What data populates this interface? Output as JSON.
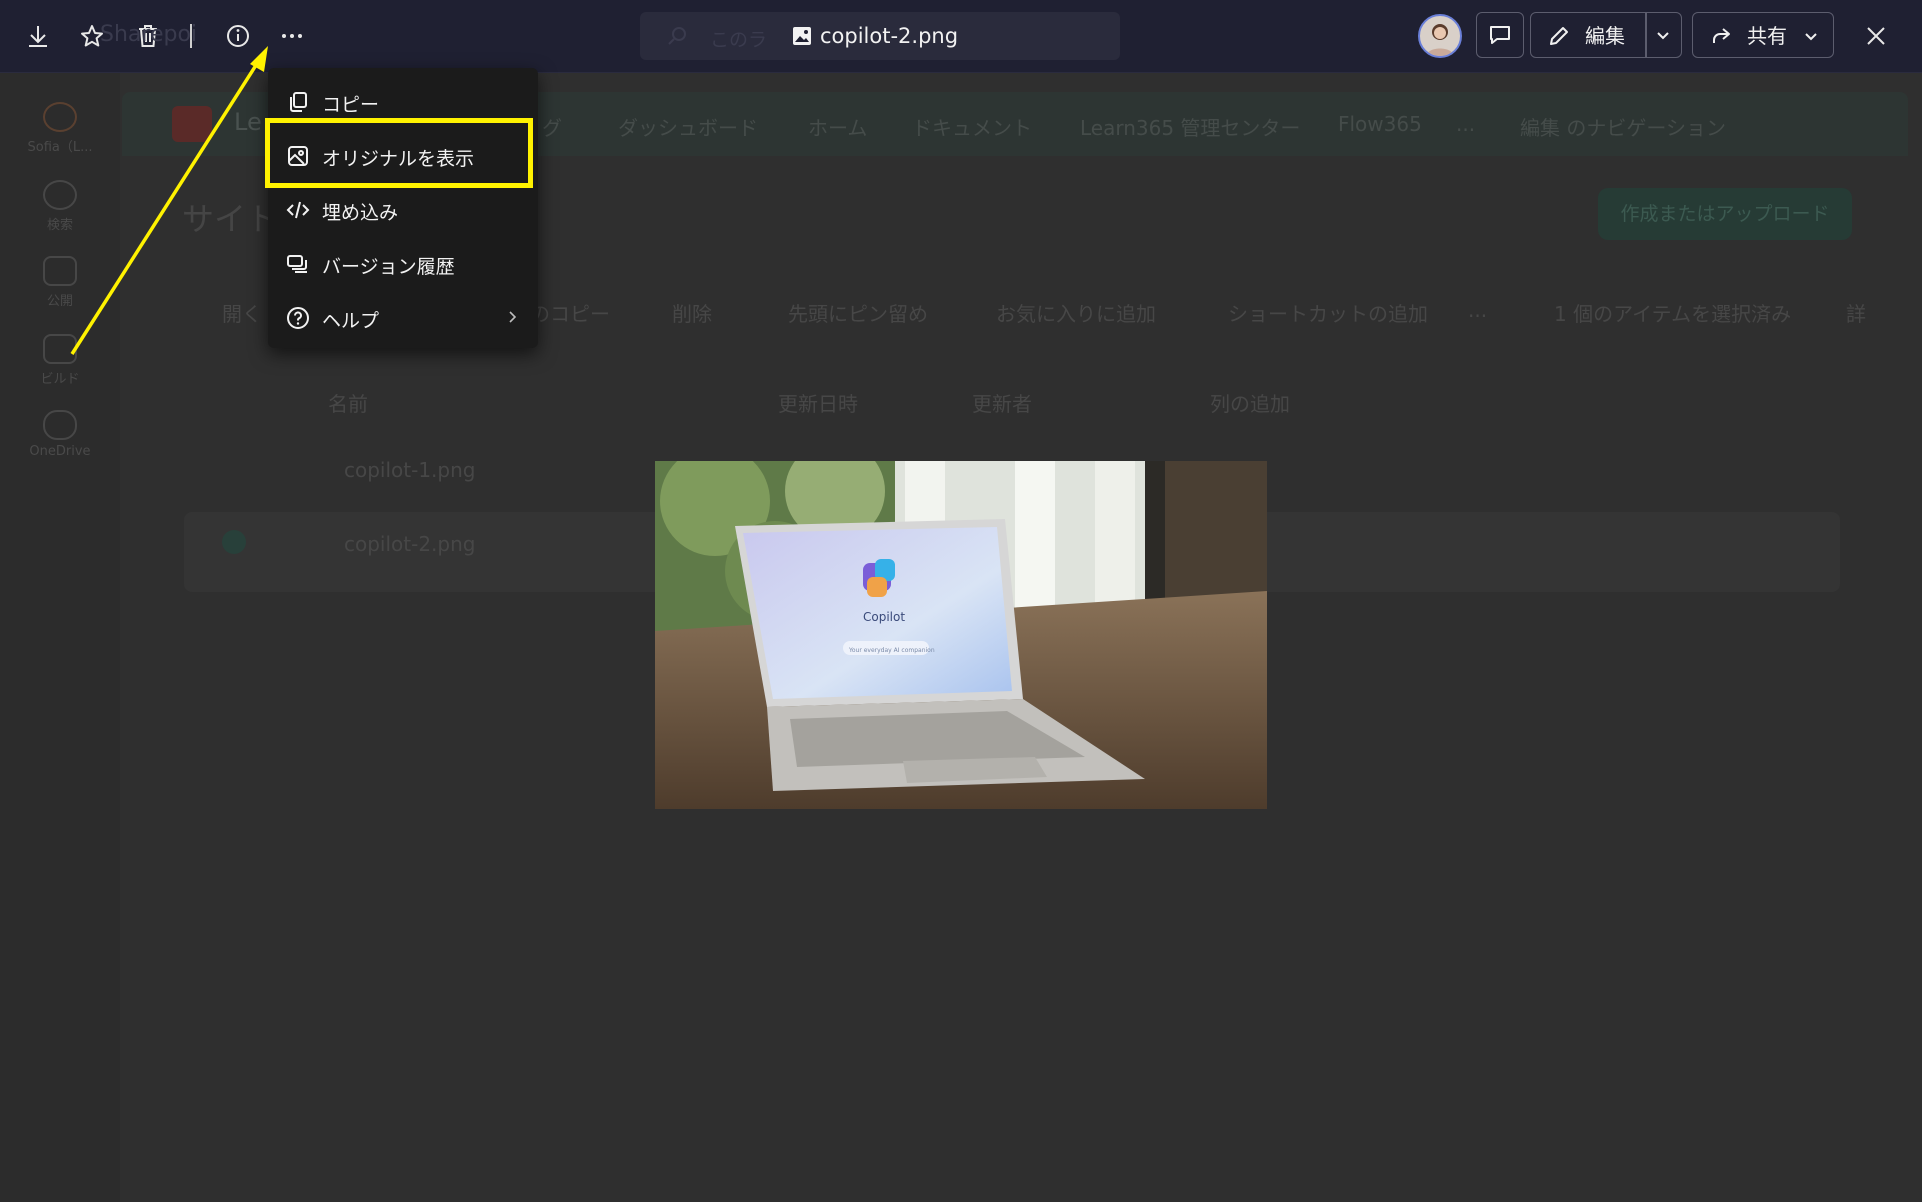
{
  "viewer": {
    "title_placeholder": "このラ",
    "file_name": "copilot-2.png",
    "edit_label": "編集",
    "share_label": "共有"
  },
  "menu": {
    "items": [
      {
        "label": "コピー",
        "icon": "copy-icon"
      },
      {
        "label": "オリジナルを表示",
        "icon": "image-icon",
        "highlighted": true
      },
      {
        "label": "埋め込み",
        "icon": "code-icon"
      },
      {
        "label": "バージョン履歴",
        "icon": "history-icon"
      },
      {
        "label": "ヘルプ",
        "icon": "help-icon",
        "has_submenu": true
      }
    ]
  },
  "background": {
    "site_short": "Le",
    "brand_partial": "Sharepoi",
    "rail": [
      {
        "label": "Sofia（L...",
        "icon": "sofia-icon"
      },
      {
        "label": "検索",
        "icon": "search-icon"
      },
      {
        "label": "公開",
        "icon": "publish-icon"
      },
      {
        "label": "ビルド",
        "icon": "build-icon"
      },
      {
        "label": "OneDrive",
        "icon": "cloud-icon"
      }
    ],
    "nav": [
      "グ",
      "ダッシュボード",
      "ホーム",
      "ドキュメント",
      "Learn365 管理センター",
      "Flow365",
      "...",
      "編集 のナビゲーション"
    ],
    "page_title": "サイトの",
    "create_button": "作成またはアップロード",
    "commands": [
      "開く",
      "のコピー",
      "削除",
      "先頭にピン留め",
      "お気に入りに追加",
      "ショートカットの追加",
      "...",
      "1 個のアイテムを選択済み",
      "詳"
    ],
    "columns": [
      "名前",
      "更新日時",
      "更新者",
      "列の追加"
    ],
    "files": [
      "copilot-1.png",
      "copilot-2.png"
    ]
  },
  "preview": {
    "caption": "Copilot",
    "sub": "Your everyday AI companion"
  },
  "colors": {
    "annotation": "#fff200",
    "topbar": "#1f2032",
    "menu_bg": "#1b1b1b"
  }
}
